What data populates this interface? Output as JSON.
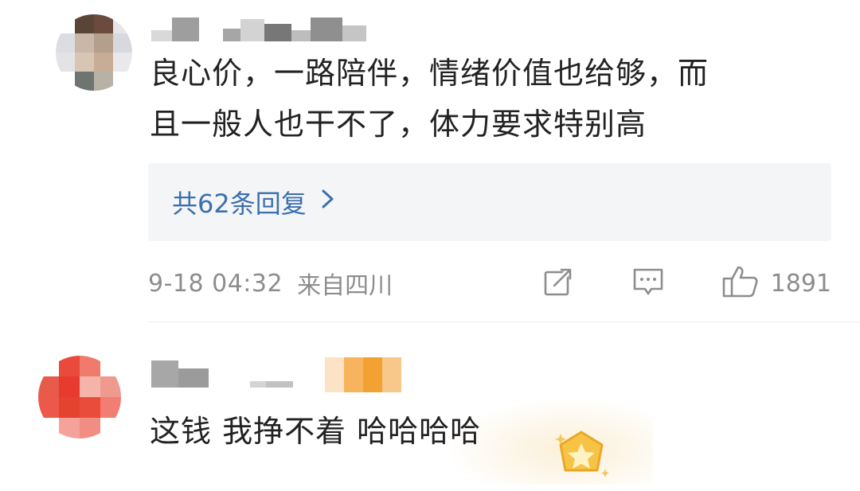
{
  "comments": [
    {
      "text": "良心价，一路陪伴，情绪价值也给够，而\n且一般人也干不了，体力要求特别高",
      "replies_label": "共62条回复",
      "date": "9-18 04:32",
      "location": "来自四川",
      "likes": "1891",
      "icons": [
        "share-icon",
        "comment-icon",
        "thumbs-up-icon",
        "chevron-right-icon"
      ]
    },
    {
      "text": "这钱 我挣不着 哈哈哈哈",
      "icons": [
        "star-badge-icon"
      ]
    }
  ],
  "colors": {
    "link": "#3c6fb0",
    "meta": "#8d8d8d",
    "text": "#222222",
    "reply_box": "#f4f5f7"
  }
}
